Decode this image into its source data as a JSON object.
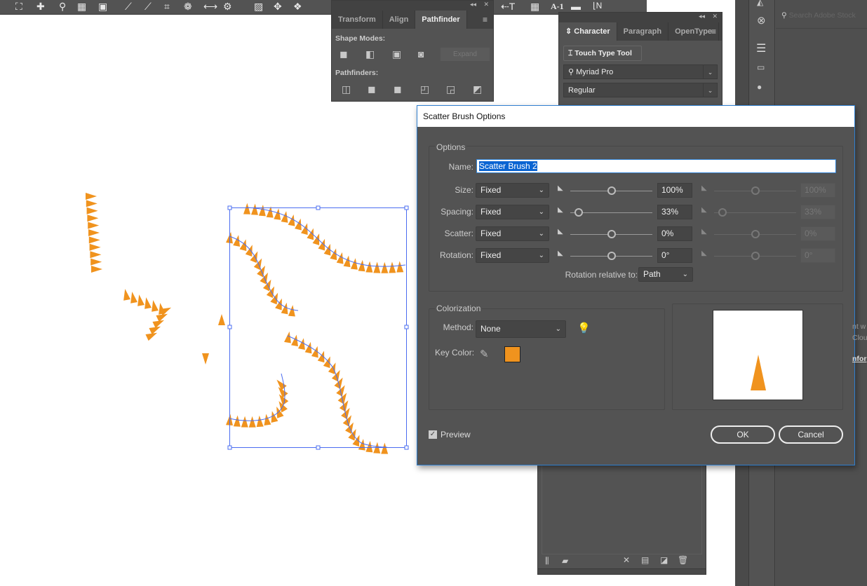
{
  "toolbar": {
    "icons": [
      "shape-builder-icon",
      "add-anchor-icon",
      "pin-icon",
      "calculator-icon",
      "symbol-icon",
      "path-icon",
      "line-icon",
      "crop-icon",
      "recolor-icon",
      "width-icon",
      "gear-icon",
      "image-trace-icon",
      "puppet-warp-icon",
      "perspective-icon"
    ],
    "right_icons": [
      "text-left-icon",
      "grid-icon",
      "ruler-icon"
    ],
    "label_a1": "A-1"
  },
  "pathfinder_panel": {
    "tabs": [
      "Transform",
      "Align",
      "Pathfinder"
    ],
    "active_tab": "Pathfinder",
    "shape_modes_label": "Shape Modes:",
    "expand_label": "Expand",
    "pathfinders_label": "Pathfinders:"
  },
  "character_panel": {
    "tabs": [
      "Character",
      "Paragraph",
      "OpenType"
    ],
    "active_tab": "Character",
    "touch_type_label": "Touch Type Tool",
    "font_family": "Myriad Pro",
    "font_style": "Regular"
  },
  "stock": {
    "search_placeholder": "Search Adobe Stock",
    "partial_text": [
      "nt w",
      "Clou",
      "nfor"
    ]
  },
  "dialog": {
    "title": "Scatter Brush Options",
    "options_label": "Options",
    "name_label": "Name:",
    "name_value": "Scatter Brush 2",
    "rows": [
      {
        "label": "Size:",
        "mode": "Fixed",
        "value": "100%",
        "value2": "100%",
        "level": 0.5
      },
      {
        "label": "Spacing:",
        "mode": "Fixed",
        "value": "33%",
        "value2": "33%",
        "level": 0.1
      },
      {
        "label": "Scatter:",
        "mode": "Fixed",
        "value": "0%",
        "value2": "0%",
        "level": 0.5
      },
      {
        "label": "Rotation:",
        "mode": "Fixed",
        "value": "0°",
        "value2": "0°",
        "level": 0.5
      }
    ],
    "rotation_relative_label": "Rotation relative to:",
    "rotation_relative_value": "Path",
    "colorization_label": "Colorization",
    "method_label": "Method:",
    "method_value": "None",
    "key_color_label": "Key Color:",
    "key_color": "#f0931e",
    "preview_label": "Preview",
    "preview_checked": true,
    "ok_label": "OK",
    "cancel_label": "Cancel"
  },
  "colors": {
    "brush": "#f0931e",
    "selection": "#4a6cf0",
    "panel": "#535353"
  }
}
